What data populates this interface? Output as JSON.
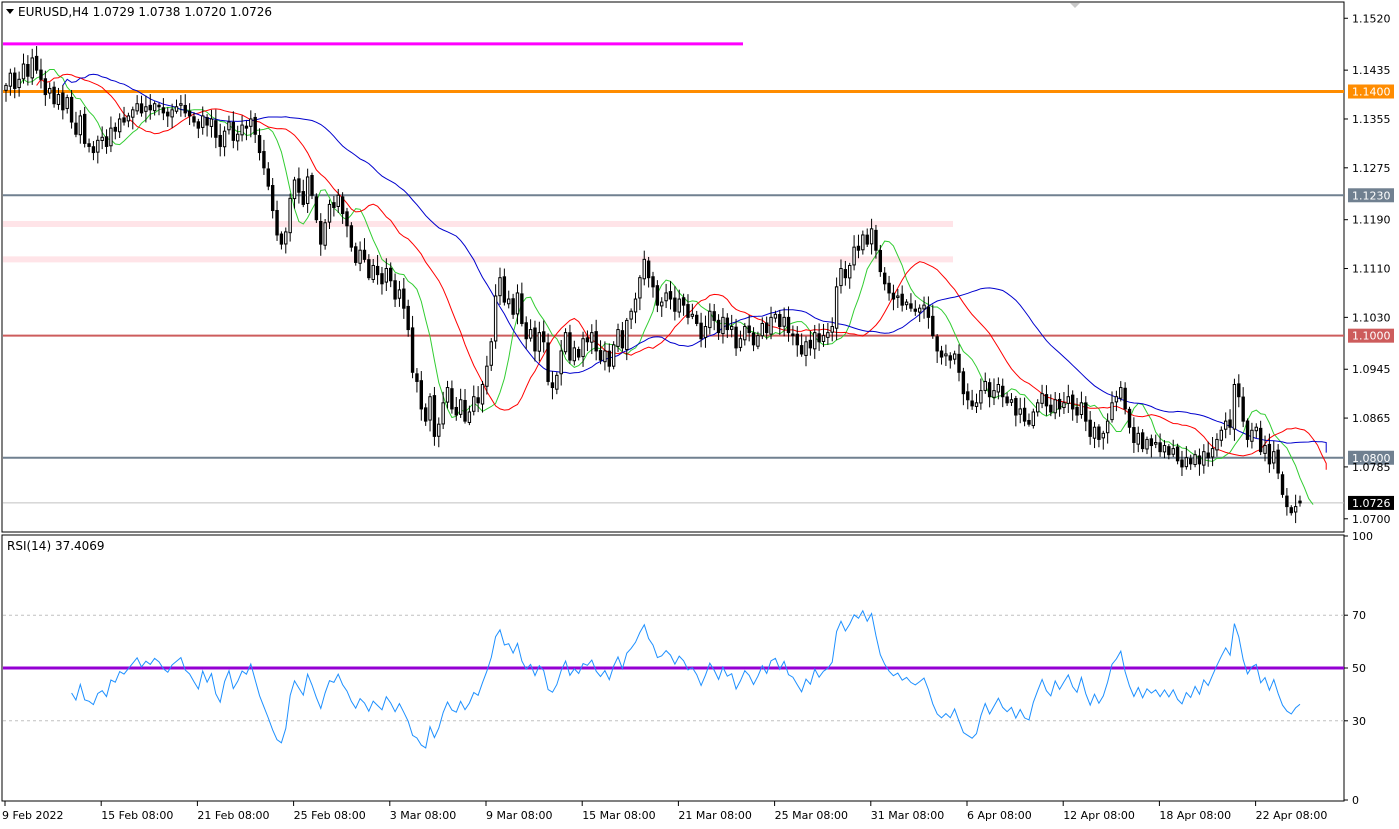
{
  "chart_data": [
    {
      "type": "candlestick",
      "symbol": "EURUSD",
      "timeframe": "H4",
      "header": "EURUSD,H4  1.0729 1.0738 1.0720 1.0726",
      "ohlc_readout": {
        "open": 1.0729,
        "high": 1.0738,
        "low": 1.072,
        "close": 1.0726
      },
      "ylim": [
        1.068,
        1.1545
      ],
      "y_ticks": [
        "1.1520",
        "1.1435",
        "1.1355",
        "1.1275",
        "1.1190",
        "1.1110",
        "1.1030",
        "1.0945",
        "1.0865",
        "1.0785",
        "1.0700"
      ],
      "x_ticks": [
        "9 Feb 2022",
        "15 Feb 08:00",
        "21 Feb 08:00",
        "25 Feb 08:00",
        "3 Mar 08:00",
        "9 Mar 08:00",
        "15 Mar 08:00",
        "21 Mar 08:00",
        "25 Mar 08:00",
        "31 Mar 08:00",
        "6 Apr 08:00",
        "12 Apr 08:00",
        "18 Apr 08:00",
        "22 Apr 08:00"
      ],
      "levels": [
        {
          "value": 1.14,
          "label": "1.1400",
          "color": "#ff8c00",
          "label_bg": "#ff8c00"
        },
        {
          "value": 1.123,
          "label": "1.1230",
          "color": "#708090",
          "label_bg": "#708090"
        },
        {
          "value": 1.1,
          "label": "1.1000",
          "color": "#cd5c5c",
          "label_bg": "#cd5c5c"
        },
        {
          "value": 1.08,
          "label": "1.0800",
          "color": "#708090",
          "label_bg": "#708090"
        }
      ],
      "partial_levels": [
        {
          "value": 1.1478,
          "color": "#ff00ff",
          "extent": "left-half"
        }
      ],
      "zones": [
        {
          "value": 1.1183,
          "color": "#ffe4e8"
        },
        {
          "value": 1.1125,
          "color": "#ffe4e8"
        }
      ],
      "current_price": "1.0726",
      "series": [
        {
          "kind": "price",
          "close": [
            1.141,
            1.143,
            1.1405,
            1.142,
            1.1445,
            1.1425,
            1.1455,
            1.1435,
            1.142,
            1.1395,
            1.1405,
            1.138,
            1.1395,
            1.137,
            1.139,
            1.135,
            1.133,
            1.136,
            1.1315,
            1.131,
            1.13,
            1.132,
            1.1325,
            1.131,
            1.134,
            1.1335,
            1.1355,
            1.135,
            1.136,
            1.137,
            1.138,
            1.1365,
            1.1375,
            1.137,
            1.138,
            1.1375,
            1.1365,
            1.136,
            1.137,
            1.1375,
            1.138,
            1.1365,
            1.136,
            1.135,
            1.134,
            1.136,
            1.1345,
            1.1355,
            1.1325,
            1.131,
            1.1335,
            1.135,
            1.132,
            1.133,
            1.1345,
            1.134,
            1.1355,
            1.133,
            1.13,
            1.1275,
            1.1245,
            1.1205,
            1.1165,
            1.115,
            1.117,
            1.1225,
            1.1255,
            1.1235,
            1.1215,
            1.126,
            1.123,
            1.119,
            1.115,
            1.1185,
            1.1215,
            1.121,
            1.123,
            1.12,
            1.118,
            1.1145,
            1.112,
            1.114,
            1.1125,
            1.1095,
            1.1115,
            1.11,
            1.1085,
            1.111,
            1.109,
            1.106,
            1.1075,
            1.1045,
            1.101,
            1.094,
            1.0925,
            1.088,
            1.086,
            1.09,
            1.0835,
            1.0855,
            1.089,
            1.0915,
            1.088,
            1.087,
            1.0895,
            1.086,
            1.0875,
            1.09,
            1.089,
            1.092,
            1.095,
            1.099,
            1.1065,
            1.1095,
            1.1055,
            1.106,
            1.1035,
            1.107,
            1.102,
            1.0995,
            1.101,
            1.0975,
            1.1005,
            1.099,
            1.0925,
            1.0915,
            1.0935,
            1.0975,
            1.1005,
            1.096,
            1.098,
            1.0965,
            1.0995,
            1.099,
            1.1005,
            1.0975,
            1.096,
            1.0975,
            1.095,
            1.0985,
            1.101,
            1.098,
            1.1025,
            1.104,
            1.106,
            1.1095,
            1.1125,
            1.1095,
            1.108,
            1.105,
            1.1055,
            1.107,
            1.106,
            1.104,
            1.106,
            1.105,
            1.103,
            1.1035,
            1.102,
            1.0995,
            1.1015,
            1.104,
            1.1025,
            1.1005,
            1.103,
            1.101,
            1.1015,
            1.098,
            1.0995,
            1.1015,
            1.1005,
            1.0985,
            1.1,
            1.102,
            1.1005,
            1.103,
            1.1035,
            1.1015,
            1.103,
            1.1005,
            1.1,
            1.0985,
            1.097,
            1.099,
            1.098,
            1.1005,
            1.099,
            1.1,
            1.1005,
            1.1015,
            1.108,
            1.111,
            1.1095,
            1.1115,
            1.1145,
            1.114,
            1.1165,
            1.115,
            1.1175,
            1.114,
            1.1105,
            1.1085,
            1.107,
            1.106,
            1.1065,
            1.105,
            1.1055,
            1.1045,
            1.104,
            1.1045,
            1.105,
            1.103,
            1.1,
            1.0975,
            1.0965,
            1.097,
            1.096,
            1.097,
            1.094,
            1.0905,
            1.0895,
            1.0885,
            1.089,
            1.091,
            1.0925,
            1.09,
            1.091,
            1.092,
            1.09,
            1.089,
            1.0895,
            1.087,
            1.088,
            1.086,
            1.0855,
            1.0875,
            1.089,
            1.0905,
            1.0885,
            1.0875,
            1.0895,
            1.088,
            1.089,
            1.09,
            1.088,
            1.087,
            1.089,
            1.086,
            1.0835,
            1.085,
            1.083,
            1.084,
            1.086,
            1.089,
            1.09,
            1.0915,
            1.088,
            1.085,
            1.0825,
            1.084,
            1.0815,
            1.083,
            1.082,
            1.0825,
            1.081,
            1.082,
            1.0805,
            1.0815,
            1.0795,
            1.0785,
            1.08,
            1.079,
            1.0805,
            1.079,
            1.081,
            1.08,
            1.0815,
            1.083,
            1.0845,
            1.086,
            1.085,
            1.092,
            1.09,
            1.086,
            1.083,
            1.0845,
            1.085,
            1.081,
            1.082,
            1.079,
            1.081,
            1.0775,
            1.074,
            1.072,
            1.071,
            1.072,
            1.0726
          ]
        },
        {
          "kind": "ma",
          "color": "#32cd32",
          "period": 5
        },
        {
          "kind": "ma",
          "color": "#ff0000",
          "period": 13
        },
        {
          "kind": "ma",
          "color": "#0000cd",
          "period": 26
        }
      ]
    },
    {
      "type": "line",
      "name": "RSI(14)",
      "header": "RSI(14) 37.4069",
      "ylim": [
        0,
        100
      ],
      "y_ticks": [
        "100",
        "70",
        "50",
        "30",
        "0"
      ],
      "levels": [
        {
          "value": 70,
          "color": "#c0c0c0",
          "style": "dotted"
        },
        {
          "value": 50,
          "color": "#9400d3",
          "style": "solid"
        },
        {
          "value": 30,
          "color": "#c0c0c0",
          "style": "dotted"
        }
      ],
      "line_color": "#1e90ff"
    }
  ]
}
